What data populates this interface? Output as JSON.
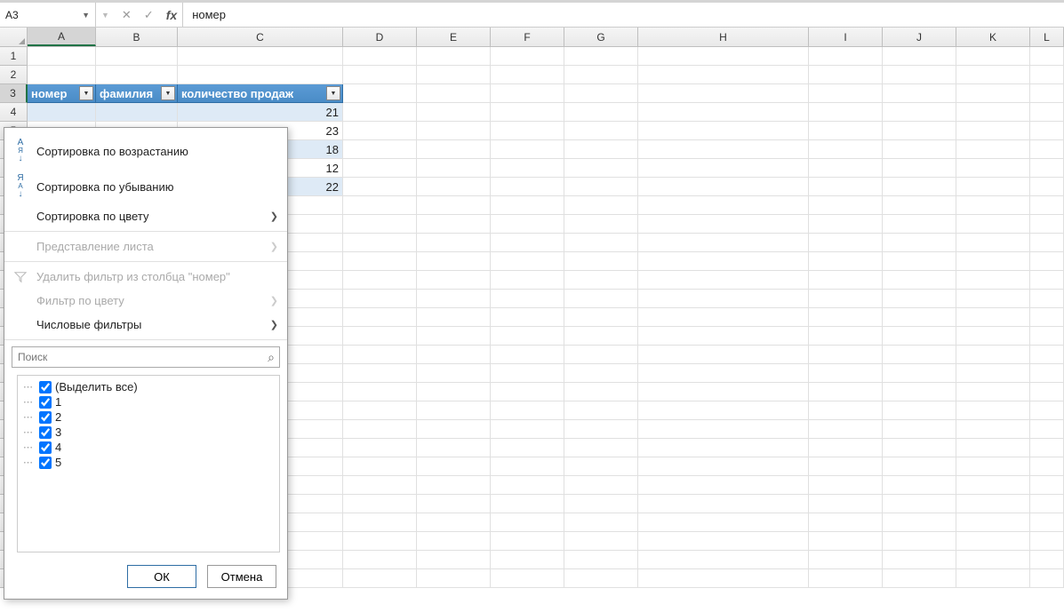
{
  "formula_bar": {
    "name_box": "A3",
    "cancel_icon": "✕",
    "enter_icon": "✓",
    "fx_label": "fx",
    "formula": "номер"
  },
  "columns": [
    "A",
    "B",
    "C",
    "D",
    "E",
    "F",
    "G",
    "H",
    "I",
    "J",
    "K",
    "L"
  ],
  "active_col_index": 0,
  "row_count": 29,
  "active_row": 3,
  "table": {
    "header_row": 3,
    "headers": [
      "номер",
      "фамилия",
      "количество продаж"
    ],
    "data": [
      {
        "c": 21
      },
      {
        "c": 23
      },
      {
        "c": 18
      },
      {
        "c": 12
      },
      {
        "c": 22
      }
    ]
  },
  "filter_menu": {
    "sort_asc": "Сортировка по возрастанию",
    "sort_desc": "Сортировка по убыванию",
    "sort_color": "Сортировка по цвету",
    "sheet_view": "Представление листа",
    "clear_filter": "Удалить фильтр из столбца \"номер\"",
    "filter_color": "Фильтр по цвету",
    "number_filters": "Числовые фильтры",
    "search_placeholder": "Поиск",
    "select_all": "(Выделить все)",
    "options": [
      "1",
      "2",
      "3",
      "4",
      "5"
    ],
    "ok": "ОК",
    "cancel": "Отмена"
  }
}
